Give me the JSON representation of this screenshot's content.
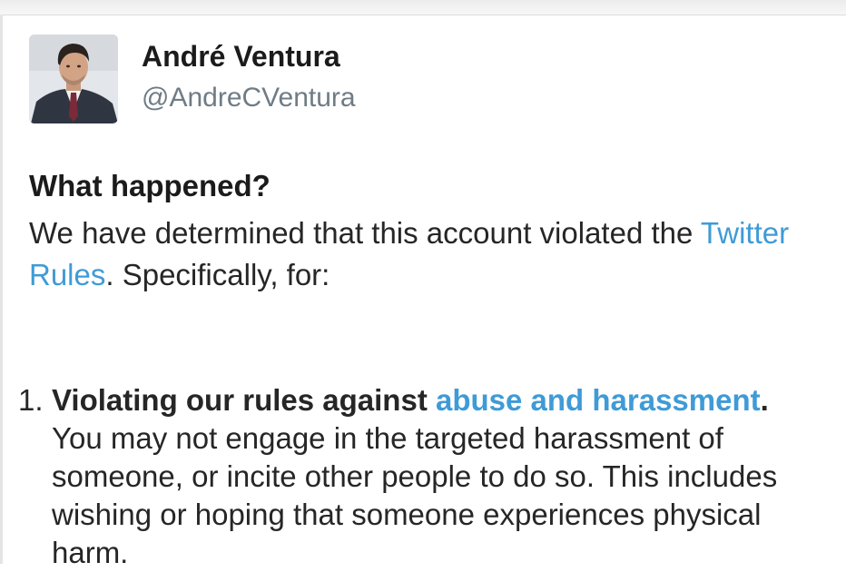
{
  "profile": {
    "display_name": "André Ventura",
    "handle": "@AndreCVentura"
  },
  "notice": {
    "title": "What happened?",
    "intro_before": "We have determined that this account violated the ",
    "intro_link": "Twitter Rules",
    "intro_after": ". Specifically, for:"
  },
  "violations": [
    {
      "number": "1.",
      "heading": "Violating our rules against ",
      "link": "abuse and harassment",
      "heading_end": ".",
      "description": "You may not engage in the targeted harassment of someone, or incite other people to do so. This includes wishing or hoping that someone experiences physical harm."
    }
  ],
  "colors": {
    "link": "#3f9bd6",
    "handle": "#6f7c85",
    "text": "#262626"
  }
}
